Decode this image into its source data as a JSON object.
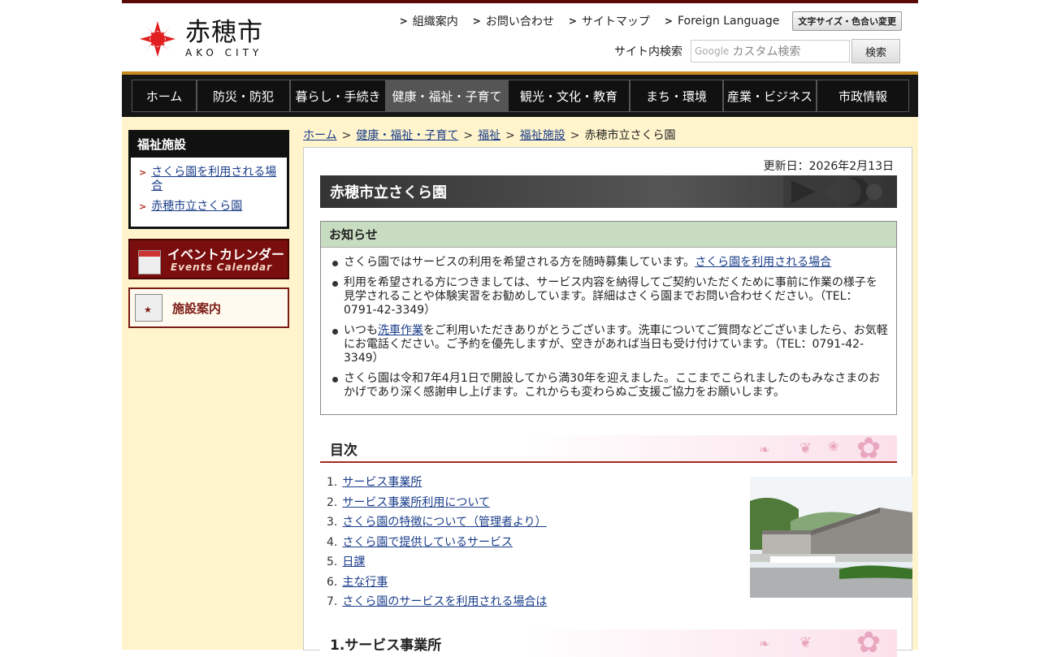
{
  "site": {
    "name_ja": "赤穂市",
    "name_en": "AKO CITY"
  },
  "util_links": [
    {
      "label": "組織案内"
    },
    {
      "label": "お問い合わせ"
    },
    {
      "label": "サイトマップ"
    },
    {
      "label": "Foreign Language"
    }
  ],
  "font_button": "文字サイズ・色合い変更",
  "search": {
    "label": "サイト内検索",
    "google": "Google",
    "placeholder": "カスタム検索",
    "button": "検索"
  },
  "nav": [
    {
      "label": "ホーム",
      "active": false
    },
    {
      "label": "防災・防犯",
      "active": false
    },
    {
      "label": "暮らし・手続き",
      "active": false
    },
    {
      "label": "健康・福祉・子育て",
      "active": true
    },
    {
      "label": "観光・文化・教育",
      "active": false
    },
    {
      "label": "まち・環境",
      "active": false
    },
    {
      "label": "産業・ビジネス",
      "active": false
    },
    {
      "label": "市政情報",
      "active": false
    }
  ],
  "sidebar": {
    "title": "福祉施設",
    "items": [
      {
        "label": "さくら園を利用される場合"
      },
      {
        "label": "赤穂市立さくら園"
      }
    ],
    "event_banner": {
      "title": "イベントカレンダー",
      "sub": "Events Calendar"
    },
    "facility_banner": "施設案内"
  },
  "breadcrumb": {
    "items": [
      "ホーム",
      "健康・福祉・子育て",
      "福祉",
      "福祉施設"
    ],
    "current": "赤穂市立さくら園",
    "sep": ">"
  },
  "page": {
    "updated": "更新日：2026年2月13日",
    "title": "赤穂市立さくら園"
  },
  "notice": {
    "title": "お知らせ",
    "items": [
      {
        "text": "さくら園ではサービスの利用を希望される方を随時募集しています。",
        "link": "さくら園を利用される場合",
        "after": ""
      },
      {
        "text": "利用を希望される方につきましては、サービス内容を納得してご契約いただくために事前に作業の様子を見学されることや体験実習をお勧めしています。詳細はさくら園までお問い合わせください。（TEL：0791-42-3349）",
        "link": "",
        "after": ""
      },
      {
        "text": "いつも",
        "link": "洗車作業",
        "after": "をご利用いただきありがとうございます。洗車についてご質問などございましたら、お気軽にお電話ください。ご予約を優先しますが、空きがあれば当日も受け付けています。（TEL：0791-42-3349）"
      },
      {
        "text": "さくら園は令和7年4月1日で開設してから満30年を迎えました。ここまでこられましたのもみなさまのおかげであり深く感謝申し上げます。これからも変わらぬご支援ご協力をお願いします。",
        "link": "",
        "after": ""
      }
    ]
  },
  "toc": {
    "title": "目次",
    "items": [
      {
        "num": "1.",
        "label": "サービス事業所"
      },
      {
        "num": "2.",
        "label": "サービス事業所利用について"
      },
      {
        "num": "3.",
        "label": "さくら園の特徴について（管理者より）"
      },
      {
        "num": "4.",
        "label": "さくら園で提供しているサービス"
      },
      {
        "num": "5.",
        "label": "日課"
      },
      {
        "num": "6.",
        "label": "主な行事"
      },
      {
        "num": "7.",
        "label": "さくら園のサービスを利用される場合は"
      }
    ]
  },
  "section1": {
    "title": "1.サービス事業所"
  },
  "colors": {
    "nav_bg": "#161616",
    "accent_red": "#a3291e",
    "gold": "#c88a1f",
    "main_bg": "#fff4cc",
    "link": "#1a3d8a"
  }
}
